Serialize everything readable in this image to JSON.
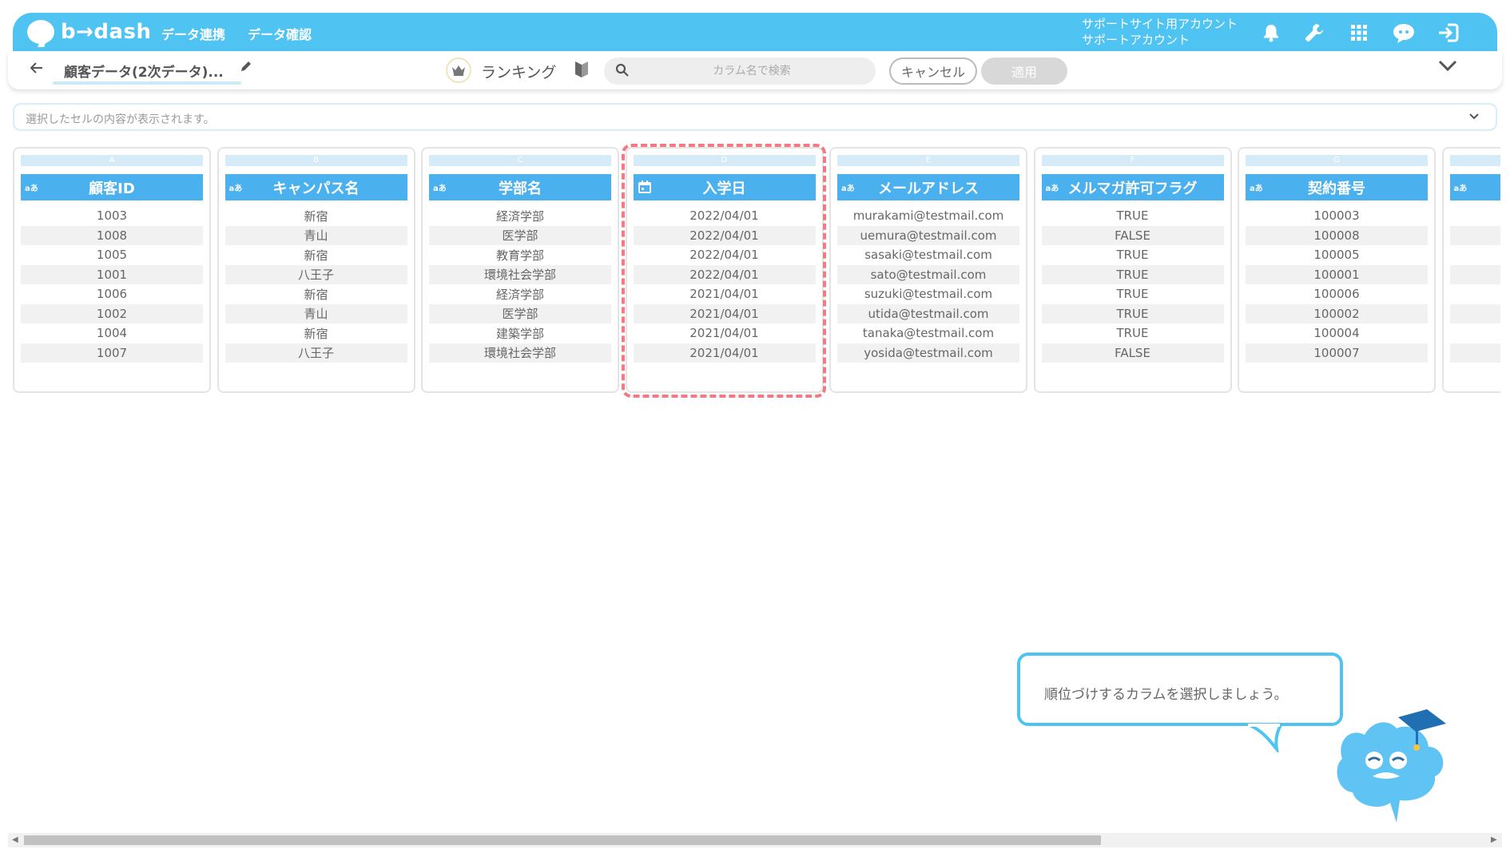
{
  "header": {
    "logo_text": "b→dash",
    "nav": [
      "データ連携",
      "データ確認"
    ],
    "account_line1": "サポートサイト用アカウント",
    "account_line2": "サポートアカウント"
  },
  "toolbar": {
    "dataset_title": "顧客データ(2次データ)...",
    "ranking_label": "ランキング",
    "search_placeholder": "カラム名で検索",
    "cancel_label": "キャンセル",
    "apply_label": "適用"
  },
  "cell_content_bar": {
    "placeholder": "選択したセルの内容が表示されます。"
  },
  "columns": [
    {
      "letter": "A",
      "name": "顧客ID",
      "type_badge": "aあ",
      "cells": [
        "1003",
        "1008",
        "1005",
        "1001",
        "1006",
        "1002",
        "1004",
        "1007"
      ]
    },
    {
      "letter": "B",
      "name": "キャンパス名",
      "type_badge": "aあ",
      "cells": [
        "新宿",
        "青山",
        "新宿",
        "八王子",
        "新宿",
        "青山",
        "新宿",
        "八王子"
      ]
    },
    {
      "letter": "C",
      "name": "学部名",
      "type_badge": "aあ",
      "cells": [
        "経済学部",
        "医学部",
        "教育学部",
        "環境社会学部",
        "経済学部",
        "医学部",
        "建築学部",
        "環境社会学部"
      ]
    },
    {
      "letter": "D",
      "name": "入学日",
      "type_badge": "calendar",
      "cells": [
        "2022/04/01",
        "2022/04/01",
        "2022/04/01",
        "2022/04/01",
        "2021/04/01",
        "2021/04/01",
        "2021/04/01",
        "2021/04/01"
      ]
    },
    {
      "letter": "E",
      "name": "メールアドレス",
      "type_badge": "aあ",
      "cells": [
        "murakami@testmail.com",
        "uemura@testmail.com",
        "sasaki@testmail.com",
        "sato@testmail.com",
        "suzuki@testmail.com",
        "utida@testmail.com",
        "tanaka@testmail.com",
        "yosida@testmail.com"
      ]
    },
    {
      "letter": "F",
      "name": "メルマガ許可フラグ",
      "type_badge": "aあ",
      "cells": [
        "TRUE",
        "FALSE",
        "TRUE",
        "TRUE",
        "TRUE",
        "TRUE",
        "TRUE",
        "FALSE"
      ]
    },
    {
      "letter": "G",
      "name": "契約番号",
      "type_badge": "aあ",
      "cells": [
        "100003",
        "100008",
        "100005",
        "100001",
        "100006",
        "100002",
        "100004",
        "100007"
      ]
    },
    {
      "letter": "",
      "name": "",
      "type_badge": "aあ",
      "cells": [
        "",
        "",
        "",
        "",
        "",
        "",
        "",
        ""
      ]
    }
  ],
  "tooltip": {
    "text": "順位づけするカラムを選択しましょう。"
  },
  "colors": {
    "header_bg": "#4fc4f3",
    "column_header": "#4ab0ee",
    "highlight": "#f27a84"
  }
}
